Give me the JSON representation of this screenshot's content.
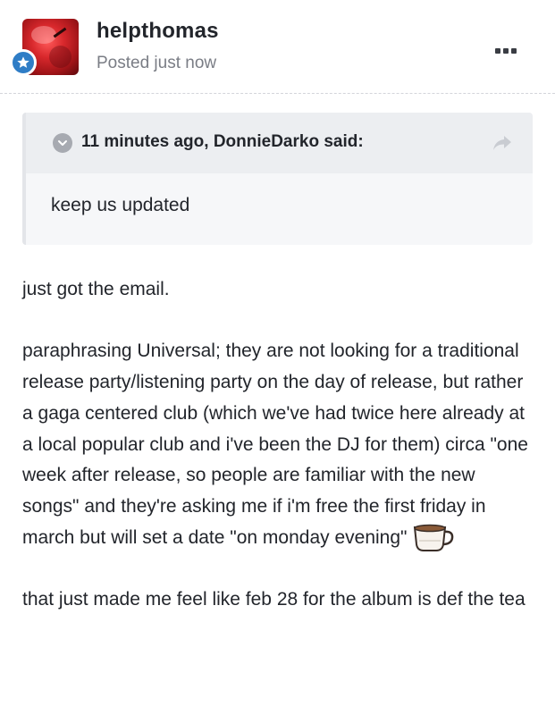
{
  "post": {
    "username": "helpthomas",
    "posted": "Posted just now",
    "badge_icon": "star-icon",
    "menu_icon": "more-options-icon"
  },
  "quote": {
    "citation": "11 minutes ago, DonnieDarko said:",
    "body": "keep us updated",
    "collapse_icon": "chevron-down-icon",
    "share_icon": "share-arrow-icon"
  },
  "content": {
    "p1": "just got the email.",
    "p2": "paraphrasing Universal; they are not looking for a traditional release party/listening party on the day of release, but rather a gaga centered club (which we've had twice here already at a local popular club and i've been the DJ for them) circa \"one week after release, so people are familiar with the new songs\" and they're asking me if i'm free the first friday in march but will set a date \"on monday evening\"",
    "emoji": "teacup-emoji",
    "p3": "that just made me feel like feb 28 for the album  is def the tea"
  },
  "colors": {
    "badge": "#2f7dc6",
    "quote_bg": "#f6f7f9",
    "quote_head_bg": "#eceef1",
    "text": "#22252b",
    "muted": "#7a7d85"
  }
}
